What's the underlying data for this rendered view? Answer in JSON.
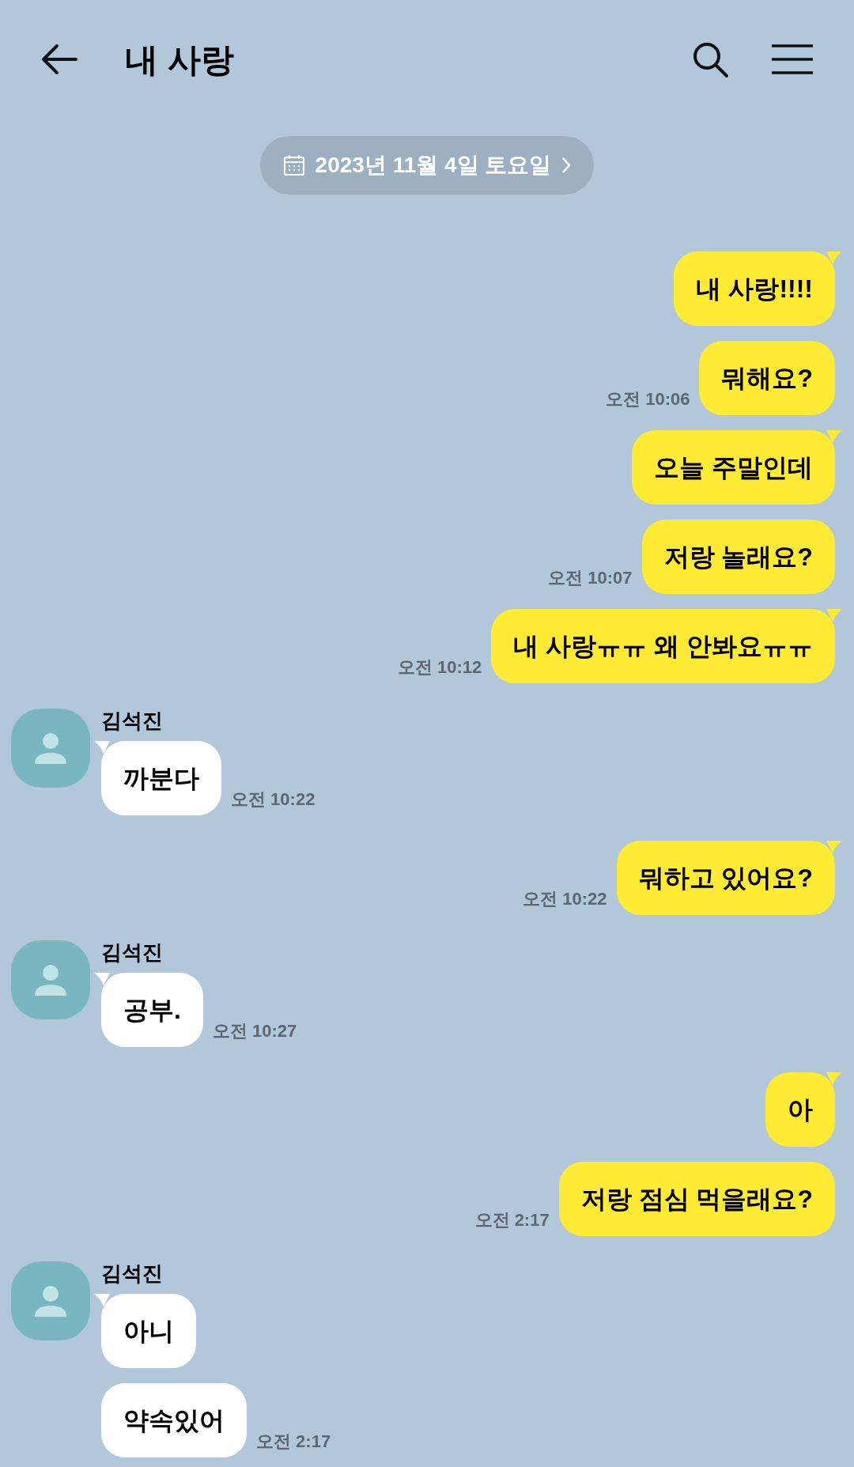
{
  "header": {
    "title": "내 사랑"
  },
  "date_pill": {
    "label": "2023년 11월 4일 토요일"
  },
  "groups": [
    {
      "kind": "sent",
      "bubbles": [
        {
          "text": "내 사랑!!!!",
          "tail": true
        },
        {
          "text": "뭐해요?",
          "tail": false,
          "time": "오전 10:06"
        },
        {
          "text": "오늘 주말인데",
          "tail": true
        },
        {
          "text": "저랑 놀래요?",
          "tail": false,
          "time": "오전 10:07"
        },
        {
          "text": "내 사랑ㅠㅠ 왜 안봐요ㅠㅠ",
          "tail": true,
          "time": "오전 10:12"
        }
      ]
    },
    {
      "kind": "received",
      "sender": "김석진",
      "bubbles": [
        {
          "text": "까분다",
          "tail": true,
          "time": "오전 10:22"
        }
      ]
    },
    {
      "kind": "sent",
      "bubbles": [
        {
          "text": "뭐하고 있어요?",
          "tail": true,
          "time": "오전 10:22"
        }
      ]
    },
    {
      "kind": "received",
      "sender": "김석진",
      "bubbles": [
        {
          "text": "공부.",
          "tail": true,
          "time": "오전 10:27"
        }
      ]
    },
    {
      "kind": "sent",
      "bubbles": [
        {
          "text": "아",
          "tail": true
        },
        {
          "text": "저랑 점심 먹을래요?",
          "tail": false,
          "time": "오전 2:17"
        }
      ]
    },
    {
      "kind": "received",
      "sender": "김석진",
      "bubbles": [
        {
          "text": "아니",
          "tail": true
        },
        {
          "text": "약속있어",
          "tail": false,
          "time": "오전 2:17"
        }
      ]
    }
  ]
}
